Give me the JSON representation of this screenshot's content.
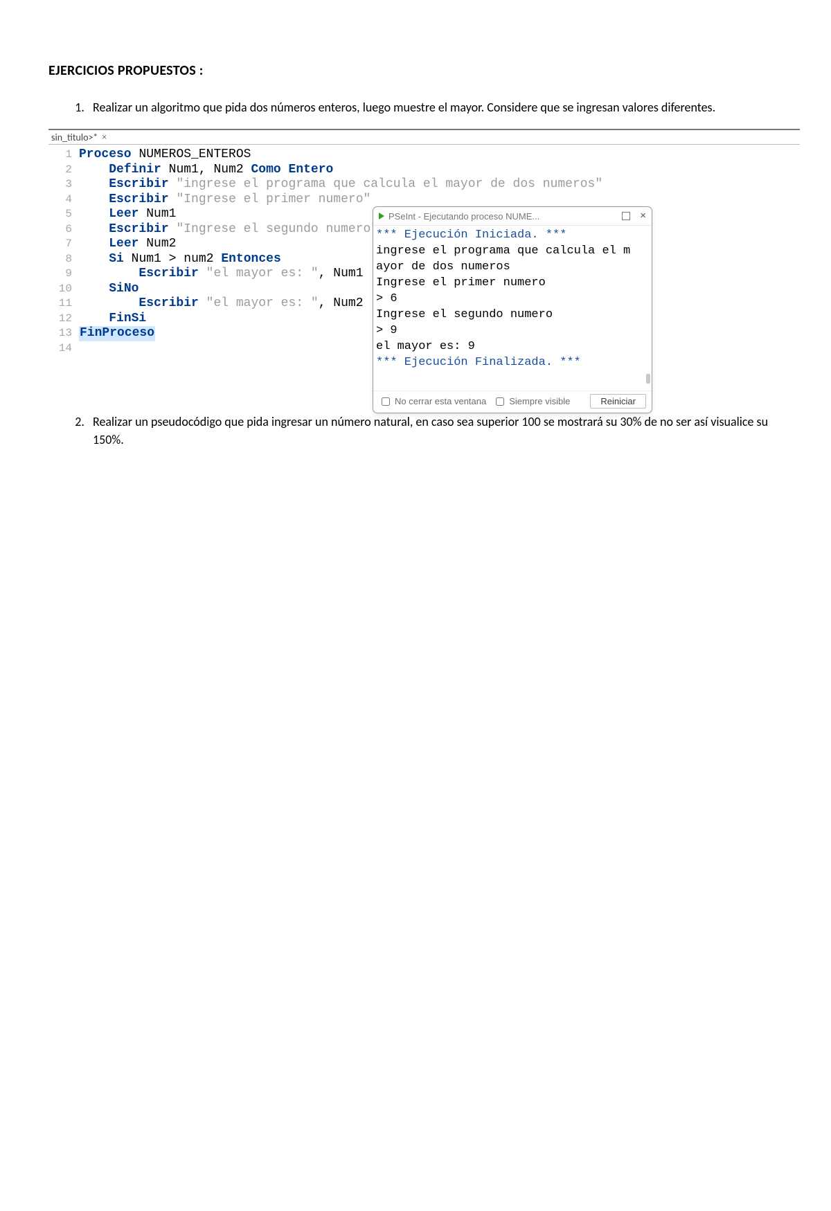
{
  "doc": {
    "section_title": "EJERCICIOS PROPUESTOS  :",
    "exercise1": "Realizar un algoritmo que pida dos números enteros, luego muestre el mayor. Considere que se ingresan valores diferentes.",
    "exercise2": "Realizar un pseudocódigo que pida ingresar un número natural, en caso sea superior 100 se mostrará su 30% de no ser así visualice su 150%."
  },
  "editor": {
    "tab_label": "sin_titulo>*",
    "tab_close": "×",
    "lines": {
      "n1": "1",
      "n2": "2",
      "n3": "3",
      "n4": "4",
      "n5": "5",
      "n6": "6",
      "n7": "7",
      "n8": "8",
      "n9": "9",
      "n10": "10",
      "n11": "11",
      "n12": "12",
      "n13": "13",
      "n14": "14"
    },
    "kw": {
      "proceso": "Proceso",
      "definir": "Definir",
      "como": "Como",
      "entero": "Entero",
      "escribir": "Escribir",
      "leer": "Leer",
      "si": "Si",
      "entonces": "Entonces",
      "sino": "SiNo",
      "finsi": "FinSi",
      "finproceso": "FinProceso"
    },
    "id": {
      "proc_name": "NUMEROS_ENTEROS",
      "defvars": "Num1, Num2",
      "num1": "Num1",
      "num2": "Num2",
      "num1l": "Num1",
      "num2l": "num2"
    },
    "str": {
      "s1": "\"ingrese el programa que calcula el mayor de dos numeros\"",
      "s2": "\"Ingrese el primer numero\"",
      "s3": "\"Ingrese el segundo numero\"",
      "s4": "\"el mayor es: \"",
      "s5": "\"el mayor es: \""
    },
    "gt": ">",
    "comma_num1": ", Num1",
    "comma_num2": ", Num2"
  },
  "exec": {
    "window_title": "PSeInt - Ejecutando proceso NUME...",
    "lines": {
      "l0": "*** Ejecución Iniciada. ***",
      "l1": "ingrese el programa que calcula el m",
      "l2": "ayor de dos numeros",
      "l3": "Ingrese el primer numero",
      "l4": "> 6",
      "l5": "Ingrese el segundo numero",
      "l6": "> 9",
      "l7": "el mayor es: 9",
      "l8": "*** Ejecución Finalizada. ***"
    },
    "footer": {
      "chk1": "No cerrar esta ventana",
      "chk2": "Siempre visible",
      "btn": "Reiniciar"
    }
  }
}
